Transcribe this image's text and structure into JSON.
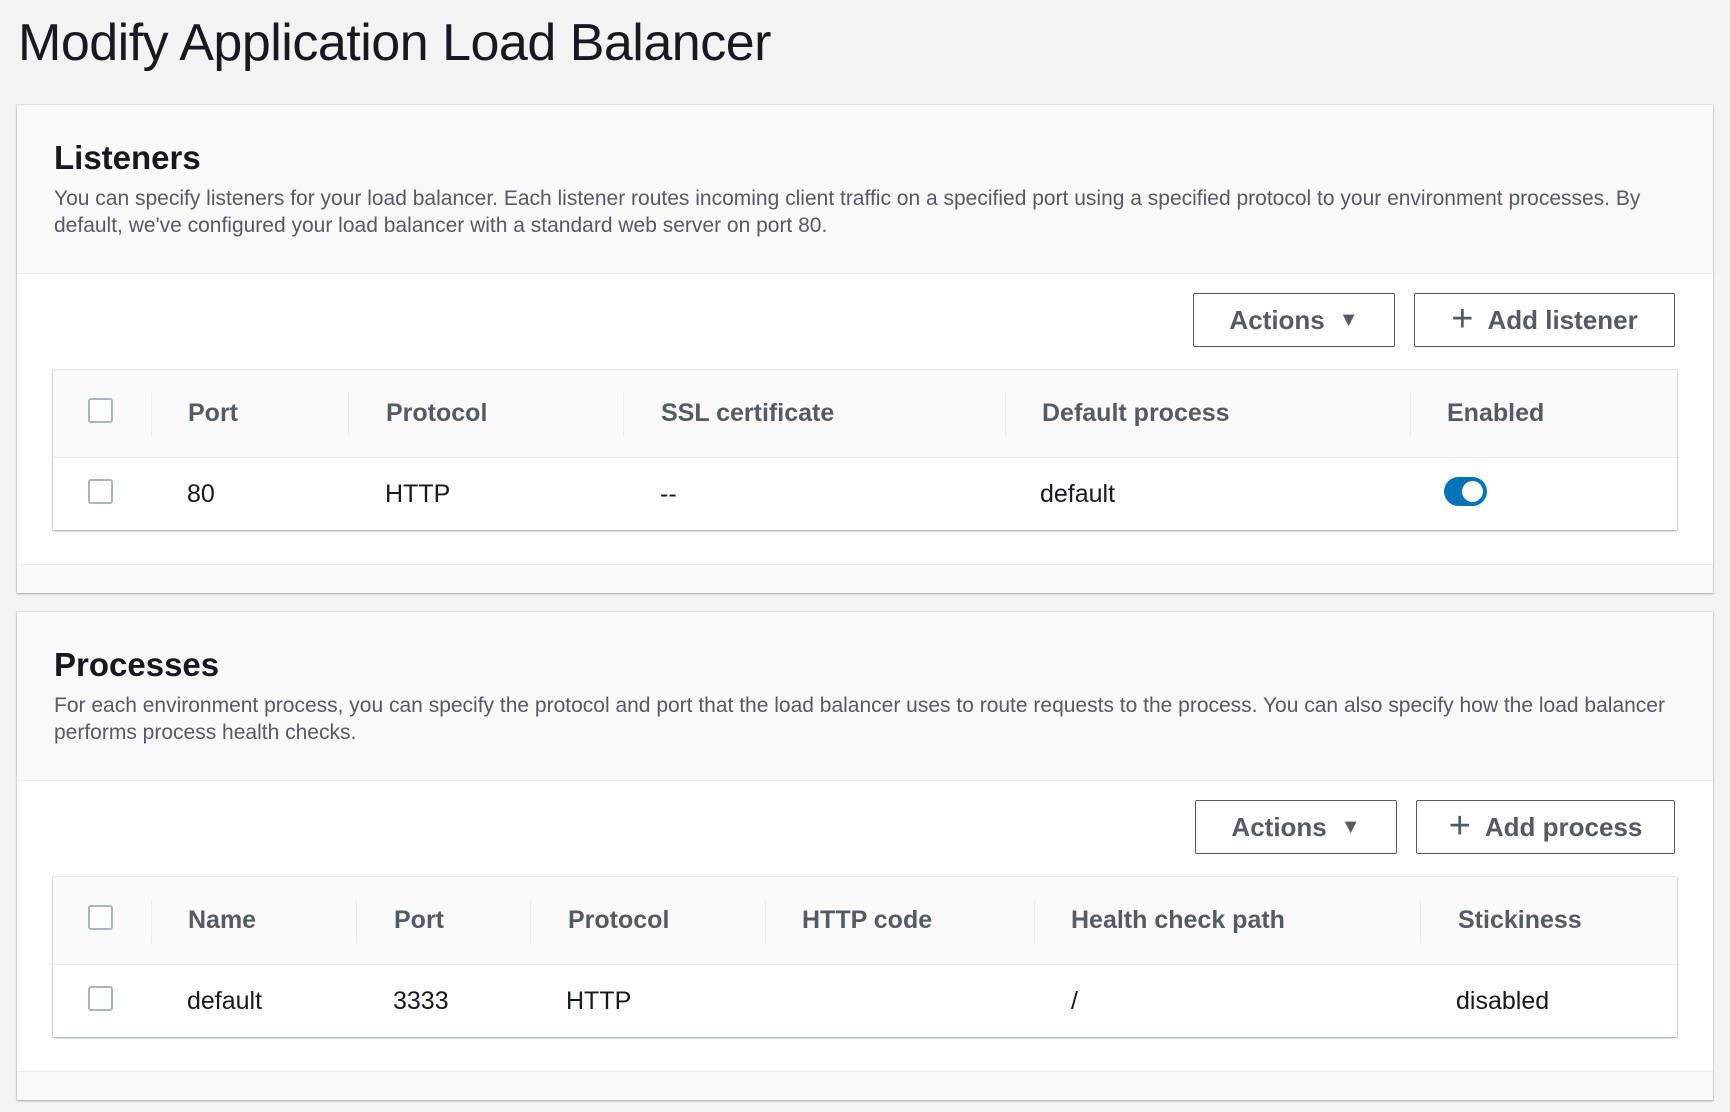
{
  "page": {
    "title": "Modify Application Load Balancer"
  },
  "listeners": {
    "heading": "Listeners",
    "description": "You can specify listeners for your load balancer. Each listener routes incoming client traffic on a specified port using a specified protocol to your environment processes. By default, we've configured your load balancer with a standard web server on port 80.",
    "actions_label": "Actions",
    "add_label": "Add listener",
    "columns": [
      "Port",
      "Protocol",
      "SSL certificate",
      "Default process",
      "Enabled"
    ],
    "rows": [
      {
        "port": "80",
        "protocol": "HTTP",
        "ssl_certificate": "--",
        "default_process": "default",
        "enabled": true,
        "selected": false
      }
    ]
  },
  "processes": {
    "heading": "Processes",
    "description": "For each environment process, you can specify the protocol and port that the load balancer uses to route requests to the process. You can also specify how the load balancer performs process health checks.",
    "actions_label": "Actions",
    "add_label": "Add process",
    "columns": [
      "Name",
      "Port",
      "Protocol",
      "HTTP code",
      "Health check path",
      "Stickiness"
    ],
    "rows": [
      {
        "name": "default",
        "port": "3333",
        "protocol": "HTTP",
        "http_code": "",
        "health_check_path": "/",
        "stickiness": "disabled",
        "selected": false
      }
    ]
  },
  "icons": {
    "dropdown": "caret-down-icon",
    "add": "plus-icon",
    "toggle": "toggle-on-icon"
  },
  "colors": {
    "toggle_on": "#0073bb",
    "button_text": "#545b64",
    "page_bg": "#f2f3f3"
  }
}
